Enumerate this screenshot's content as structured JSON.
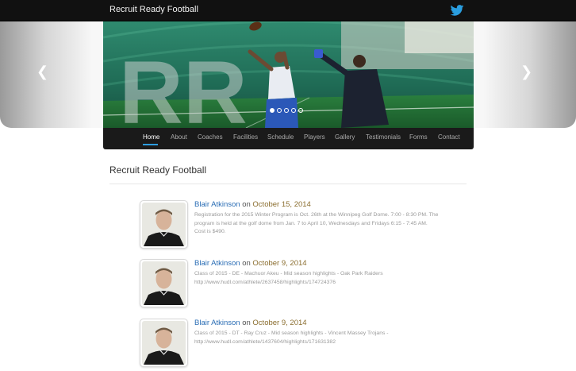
{
  "header": {
    "brand": "Recruit Ready Football",
    "social_icon": "twitter-icon"
  },
  "carousel": {
    "prev_icon": "chevron-left-icon",
    "next_icon": "chevron-right-icon",
    "logo_letters": "RR",
    "slide_count": 5,
    "active_slide": 1
  },
  "nav": {
    "items": [
      {
        "label": "Home",
        "active": true
      },
      {
        "label": "About"
      },
      {
        "label": "Coaches"
      },
      {
        "label": "Facilities"
      },
      {
        "label": "Schedule"
      },
      {
        "label": "Players"
      },
      {
        "label": "Gallery"
      },
      {
        "label": "Testimonials"
      },
      {
        "label": "Forms"
      },
      {
        "label": "Contact"
      }
    ]
  },
  "page": {
    "title": "Recruit Ready Football"
  },
  "posts": [
    {
      "author": "Blair Atkinson",
      "on": "on",
      "date": "October 15, 2014",
      "body": [
        "Registration for the 2015 Winter Program is Oct. 26th at the Winnipeg Golf Dome. 7:00 - 8:30 PM. The",
        "program is held at the golf dome from Jan. 7 to April 10, Wednesdays and Fridays 6:15 - 7:45 AM.",
        "Cost is $490."
      ]
    },
    {
      "author": "Blair Atkinson",
      "on": "on",
      "date": "October 9, 2014",
      "body": [
        "Class of 2015 - DE - Machuor Akeu - Mid season highlights - Oak Park Raiders",
        "http://www.hudl.com/athlete/2637458/highlights/174724376"
      ]
    },
    {
      "author": "Blair Atkinson",
      "on": "on",
      "date": "October 9, 2014",
      "body": [
        "Class of 2015 - DT - Ray Cruz - Mid season highlights - Vincent Massey Trojans -",
        "http://www.hudl.com/athlete/1437604/highlights/171631382"
      ]
    }
  ]
}
